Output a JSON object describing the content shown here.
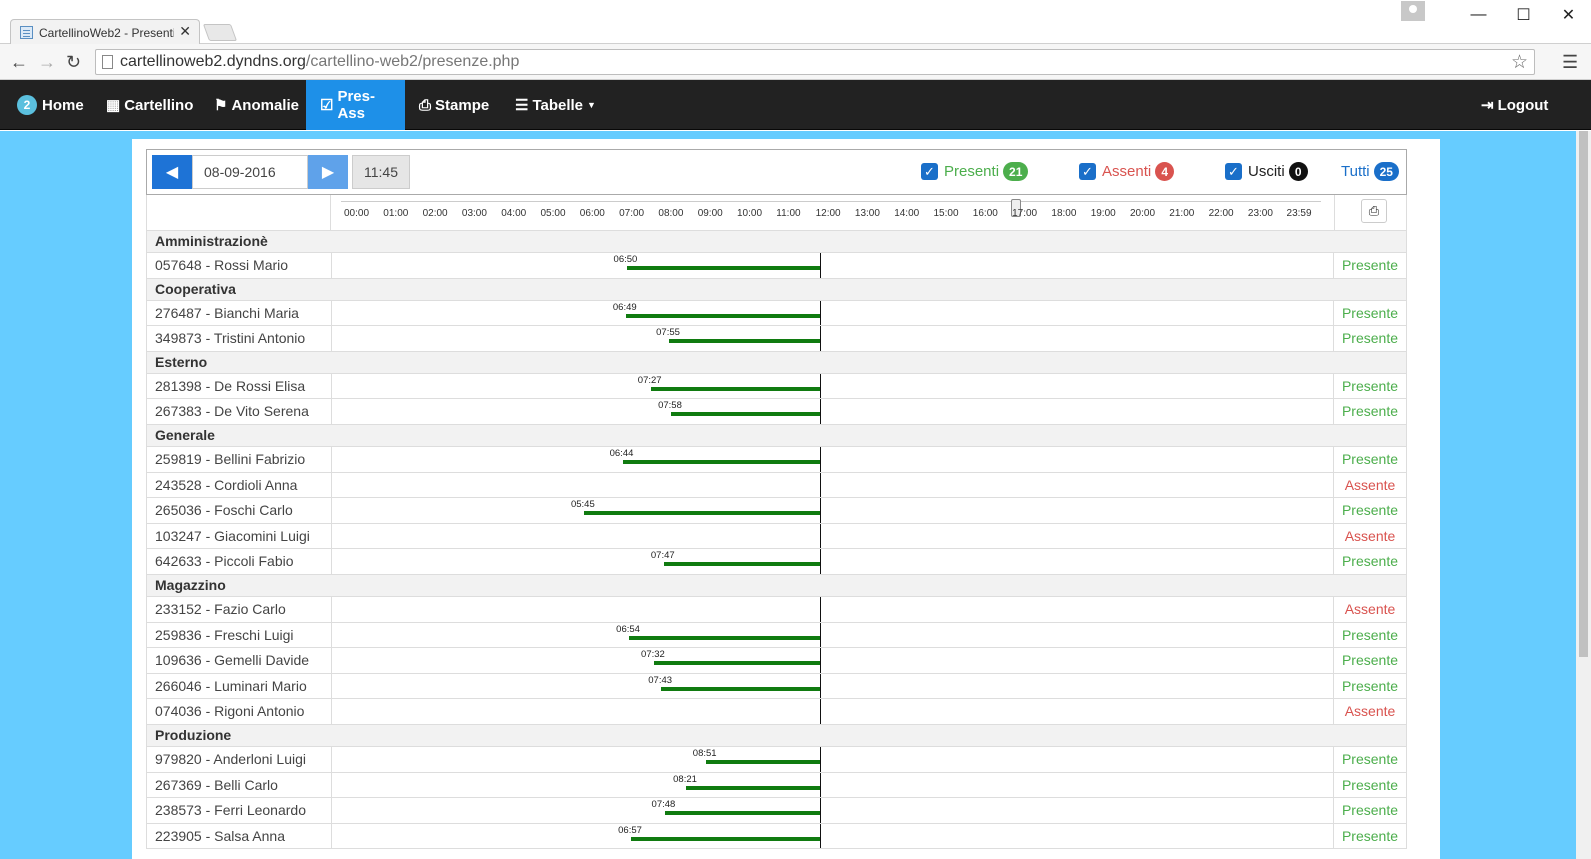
{
  "browser": {
    "tab_title": "CartellinoWeb2 - Presenti",
    "url_host": "cartellinoweb2.dyndns.org",
    "url_path": "/cartellino-web2/presenze.php"
  },
  "nav": {
    "home_badge": "2",
    "home": "Home",
    "cartellino": "Cartellino",
    "anomalie": "Anomalie",
    "presass": "Pres-Ass",
    "stampe": "Stampe",
    "tabelle": "Tabelle",
    "logout": "Logout"
  },
  "toolbar": {
    "date": "08-09-2016",
    "time": "11:45",
    "presenti_label": "Presenti",
    "presenti_count": "21",
    "assenti_label": "Assenti",
    "assenti_count": "4",
    "usciti_label": "Usciti",
    "usciti_count": "0",
    "tutti_label": "Tutti",
    "tutti_count": "25"
  },
  "hours": [
    "00:00",
    "01:00",
    "02:00",
    "03:00",
    "04:00",
    "05:00",
    "06:00",
    "07:00",
    "08:00",
    "09:00",
    "10:00",
    "11:00",
    "12:00",
    "13:00",
    "14:00",
    "15:00",
    "16:00",
    "17:00",
    "18:00",
    "19:00",
    "20:00",
    "21:00",
    "22:00",
    "23:00",
    "23:59"
  ],
  "now_minutes": 705,
  "groups": [
    {
      "name": "Amministrazionè",
      "rows": [
        {
          "name": "057648 - Rossi Mario",
          "status": "Presente",
          "start": "06:50"
        }
      ]
    },
    {
      "name": "Cooperativa",
      "rows": [
        {
          "name": "276487 - Bianchi Maria",
          "status": "Presente",
          "start": "06:49"
        },
        {
          "name": "349873 - Tristini Antonio",
          "status": "Presente",
          "start": "07:55"
        }
      ]
    },
    {
      "name": "Esterno",
      "rows": [
        {
          "name": "281398 - De Rossi Elisa",
          "status": "Presente",
          "start": "07:27"
        },
        {
          "name": "267383 - De Vito Serena",
          "status": "Presente",
          "start": "07:58"
        }
      ]
    },
    {
      "name": "Generale",
      "rows": [
        {
          "name": "259819 - Bellini Fabrizio",
          "status": "Presente",
          "start": "06:44"
        },
        {
          "name": "243528 - Cordioli Anna",
          "status": "Assente",
          "start": null
        },
        {
          "name": "265036 - Foschi Carlo",
          "status": "Presente",
          "start": "05:45"
        },
        {
          "name": "103247 - Giacomini Luigi",
          "status": "Assente",
          "start": null
        },
        {
          "name": "642633 - Piccoli Fabio",
          "status": "Presente",
          "start": "07:47"
        }
      ]
    },
    {
      "name": "Magazzino",
      "rows": [
        {
          "name": "233152 - Fazio Carlo",
          "status": "Assente",
          "start": null
        },
        {
          "name": "259836 - Freschi Luigi",
          "status": "Presente",
          "start": "06:54"
        },
        {
          "name": "109636 - Gemelli Davide",
          "status": "Presente",
          "start": "07:32"
        },
        {
          "name": "266046 - Luminari Mario",
          "status": "Presente",
          "start": "07:43"
        },
        {
          "name": "074036 - Rigoni Antonio",
          "status": "Assente",
          "start": null
        }
      ]
    },
    {
      "name": "Produzione",
      "rows": [
        {
          "name": "979820 - Anderloni Luigi",
          "status": "Presente",
          "start": "08:51"
        },
        {
          "name": "267369 - Belli Carlo",
          "status": "Presente",
          "start": "08:21"
        },
        {
          "name": "238573 - Ferri Leonardo",
          "status": "Presente",
          "start": "07:48"
        },
        {
          "name": "223905 - Salsa Anna",
          "status": "Presente",
          "start": "06:57"
        }
      ]
    }
  ],
  "colors": {
    "presente": "#4cae4c",
    "assente": "#d9534f",
    "bar": "#107b10",
    "nav_active": "#1e90e8",
    "page_bg": "#66ccff"
  }
}
